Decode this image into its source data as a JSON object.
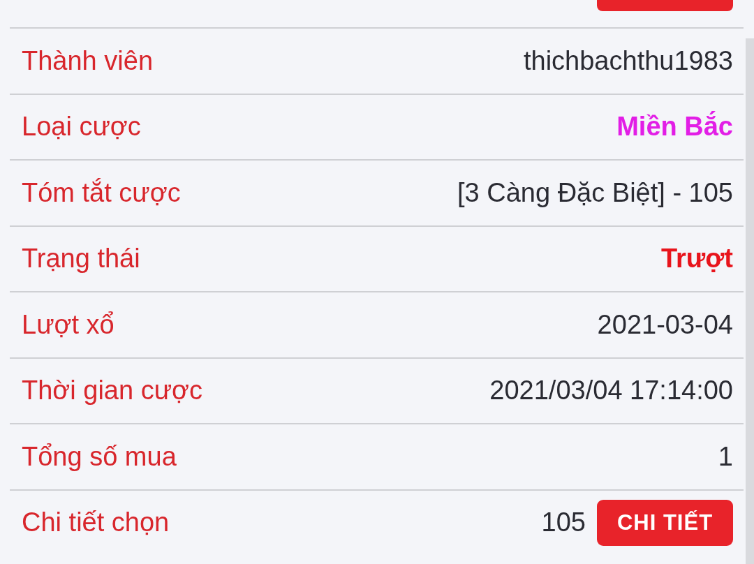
{
  "details": [
    {
      "label": "Thành viên",
      "value": "thichbachthu1983",
      "kind": "plain"
    },
    {
      "label": "Loại cược",
      "value": "Miền Bắc",
      "kind": "region"
    },
    {
      "label": "Tóm tắt cược",
      "value": "[3 Càng Đặc Biệt] - 105",
      "kind": "plain"
    },
    {
      "label": "Trạng thái",
      "value": "Trượt",
      "kind": "status"
    },
    {
      "label": "Lượt xổ",
      "value": "2021-03-04",
      "kind": "plain"
    },
    {
      "label": "Thời gian cược",
      "value": "2021/03/04 17:14:00",
      "kind": "plain"
    },
    {
      "label": "Tổng số mua",
      "value": "1",
      "kind": "plain"
    },
    {
      "label": "Chi tiết chọn",
      "value": "105",
      "kind": "button",
      "button": "CHI TIẾT"
    }
  ]
}
